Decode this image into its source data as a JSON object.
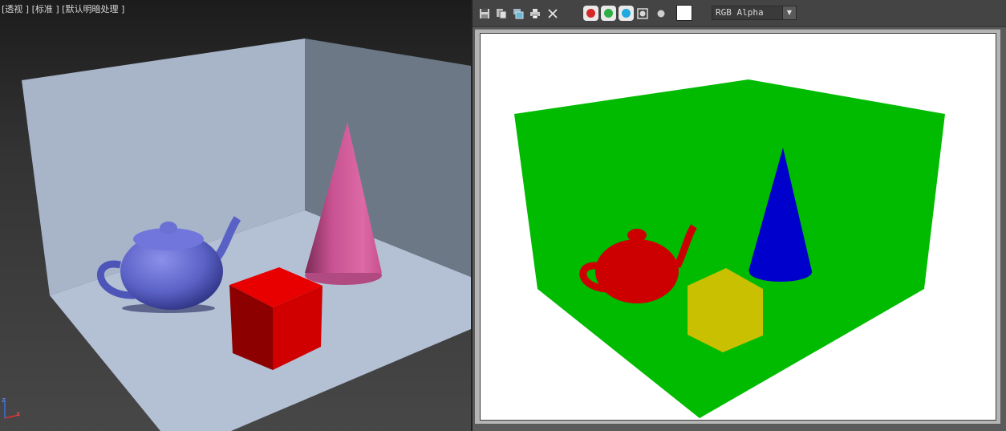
{
  "viewport": {
    "label_parts": [
      "[透视 ]",
      " [标准 ]",
      " [默认明暗处理 ]"
    ],
    "axis": {
      "z": "z",
      "x": "x"
    },
    "colors": {
      "floor": "#b4c1d5",
      "back_wall": "#a8b5c9",
      "side_wall": "#6c7886",
      "teapot": "#5c63c8",
      "cone": "#d45a98",
      "box": "#d00000"
    }
  },
  "render_window": {
    "toolbar_icons": [
      "save-icon",
      "copy-icon",
      "clone-icon",
      "print-icon",
      "close-icon"
    ],
    "channels": [
      {
        "name": "red-channel",
        "color": "#d62828"
      },
      {
        "name": "green-channel",
        "color": "#2fae45"
      },
      {
        "name": "blue-channel",
        "color": "#20a8e0"
      }
    ],
    "channel_display": {
      "value": "RGB Alpha"
    },
    "colors": {
      "room": "#00bb00",
      "teapot": "#cc0000",
      "cone": "#0000cc",
      "box": "#c8c000"
    }
  }
}
